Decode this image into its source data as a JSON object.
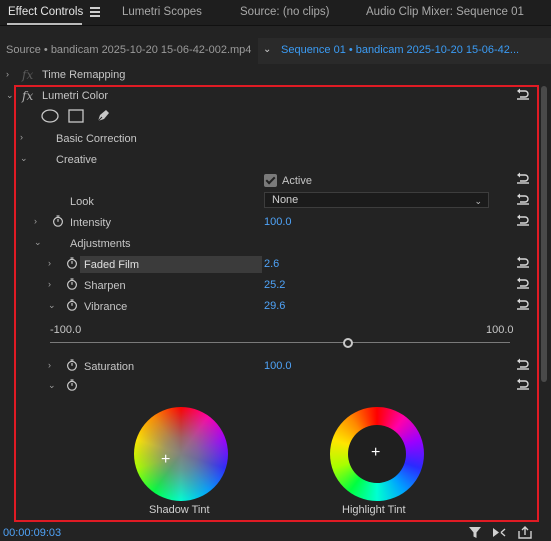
{
  "tabs": [
    {
      "label": "Effect Controls",
      "active": true
    },
    {
      "label": "Lumetri Scopes",
      "active": false
    },
    {
      "label": "Source: (no clips)",
      "active": false
    },
    {
      "label": "Audio Clip Mixer: Sequence 01",
      "active": false
    }
  ],
  "source": {
    "left_label": "Source • bandicam 2025-10-20 15-06-42-002.mp4",
    "sequence_label": "Sequence 01 • bandicam 2025-10-20 15-06-42..."
  },
  "effects": {
    "time_remapping": {
      "fx": "fx",
      "label": "Time Remapping"
    },
    "lumetri": {
      "fx": "fx",
      "label": "Lumetri Color"
    }
  },
  "sections": {
    "basic_correction": "Basic Correction",
    "creative": "Creative",
    "adjustments": "Adjustments"
  },
  "creative": {
    "active_label": "Active",
    "active_checked": true,
    "look_label": "Look",
    "look_value": "None",
    "intensity_label": "Intensity",
    "intensity_value": "100.0"
  },
  "adjustments": {
    "faded_film_label": "Faded Film",
    "faded_film_value": "2.6",
    "sharpen_label": "Sharpen",
    "sharpen_value": "25.2",
    "vibrance_label": "Vibrance",
    "vibrance_value": "29.6",
    "vibrance_min": "-100.0",
    "vibrance_max": "100.0",
    "vibrance_fraction": 0.648,
    "saturation_label": "Saturation",
    "saturation_value": "100.0"
  },
  "wheels": {
    "shadow_label": "Shadow Tint",
    "highlight_label": "Highlight Tint",
    "plus": "+"
  },
  "footer": {
    "timecode": "00:00:09:03"
  },
  "colors": {
    "accent": "#3b9cf5",
    "selection_border": "#e01b24"
  }
}
